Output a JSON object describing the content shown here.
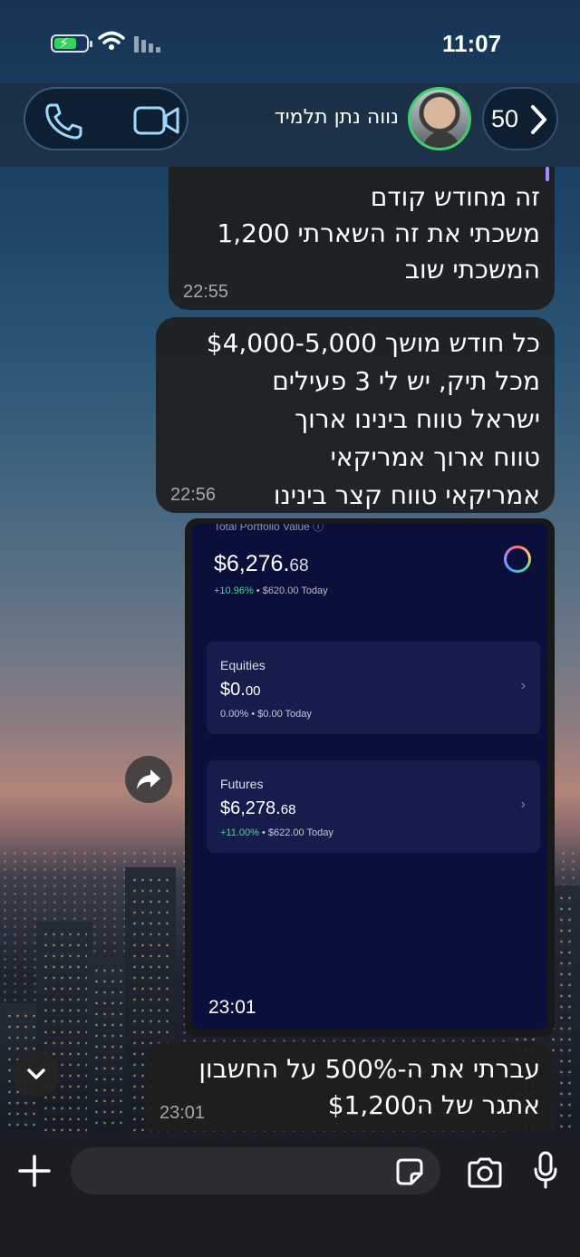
{
  "status_bar": {
    "time": "11:07"
  },
  "header": {
    "contact_name": "נווה נתן תלמיד",
    "back_count": "50"
  },
  "messages": [
    {
      "lines": [
        "זה מחודש קודם",
        "משכתי את זה השארתי 1,200",
        "המשכתי שוב"
      ],
      "time": "22:55"
    },
    {
      "lines": [
        "כל חודש מושך $4,000-5,000",
        "מכל תיק, יש לי 3 פעילים",
        "ישראל טווח בינינו ארוך",
        "טווח ארוך אמריקאי",
        "אמריקאי טווח קצר בינינו"
      ],
      "time": "22:56"
    },
    {
      "lines": [
        "עברתי את ה-500% על החשבון",
        "אתגר של ה$1,200"
      ],
      "time": "23:01"
    }
  ],
  "screenshot": {
    "time": "23:01",
    "portfolio_label": "Total Portfolio Value ⓘ",
    "portfolio_value_main": "$6,276.",
    "portfolio_value_cents": "68",
    "portfolio_change_pct": "+10.96%",
    "portfolio_change_rest": " • $620.00 Today",
    "cards": [
      {
        "title": "Equities",
        "value_main": "$0.",
        "value_cents": "00",
        "change_pct": "0.00%",
        "change_rest": " • $0.00 Today"
      },
      {
        "title": "Futures",
        "value_main": "$6,278.",
        "value_cents": "68",
        "change_pct": "+11.00%",
        "change_rest": " • $622.00 Today"
      }
    ]
  },
  "composer": {
    "placeholder": ""
  },
  "colors": {
    "online_ring": "#3fcf6a",
    "gain_green": "#4bd39a",
    "reply_bar": "#a78bfa",
    "bubble_bg": "#1e1e1e"
  }
}
